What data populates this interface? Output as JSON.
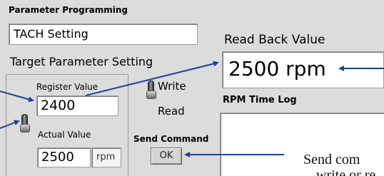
{
  "section_title": "Parameter Programming",
  "parameter_name": "TACH Setting",
  "read_back_label": "Read Back Value",
  "read_back_value": "2500 rpm",
  "target_section_title": "Target Parameter Setting",
  "register_label": "Register Value",
  "register_value": "2400",
  "actual_label": "Actual Value",
  "actual_value": "2500",
  "actual_unit": "rpm",
  "write_label": "Write",
  "read_label": "Read",
  "log_label": "RPM Time Log",
  "send_command_label": "Send Command",
  "ok_label": "OK",
  "annotation_line1": "Send com",
  "annotation_line2": "write or re",
  "colors": {
    "arrow": "#1f3f9f",
    "panel": "#dcdcdc"
  }
}
